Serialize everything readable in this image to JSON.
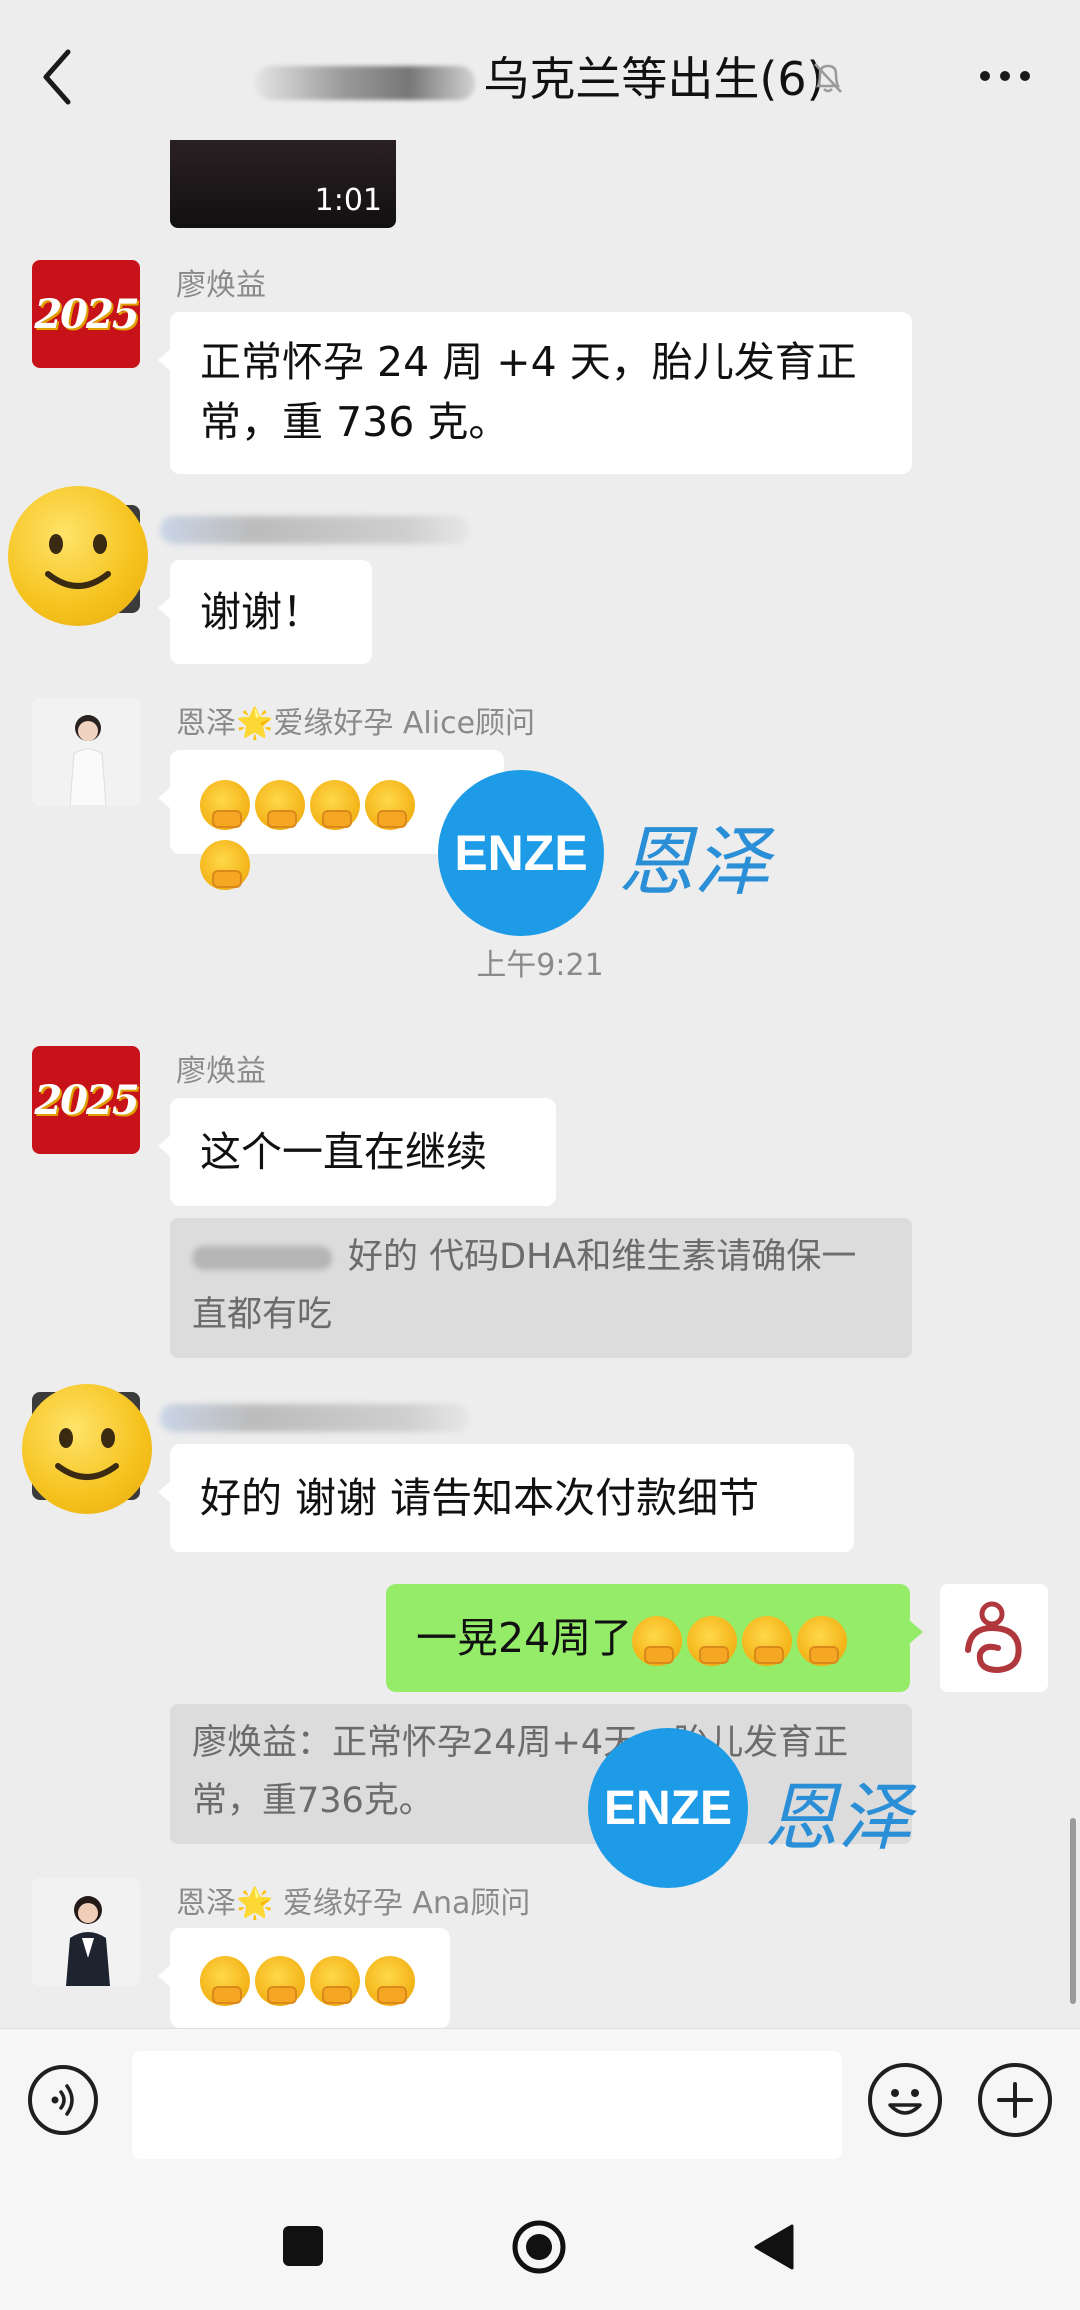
{
  "header": {
    "title": "乌克兰等出生(6)",
    "icons": [
      "back-icon",
      "mute-bell-icon",
      "more-icon"
    ]
  },
  "video": {
    "duration": "1:01"
  },
  "messages": {
    "m1": {
      "sender": "廖焕益",
      "avatar_text": "2025",
      "text_line1": "正常怀孕 24 周 +4 天，胎儿发育正",
      "text_line2": "常，重 736 克。"
    },
    "m2": {
      "text": "谢谢！"
    },
    "m3": {
      "sender": "恩泽🌟爱缘好孕 Alice顾问",
      "emoji_count": 5
    },
    "timestamp": "上午9:21",
    "m4": {
      "sender": "廖焕益",
      "avatar_text": "2025",
      "text": "这个一直在继续",
      "quote_line1": "好的 代码DHA和维生素请确保一",
      "quote_line2": "直都有吃"
    },
    "m5": {
      "text": "好的 谢谢 请告知本次付款细节"
    },
    "m6": {
      "text": "一晃24周了",
      "emoji_count": 4,
      "quote_line1": "廖焕益：正常怀孕24周+4天，胎儿发育正",
      "quote_line2": "常，重736克。"
    },
    "m7": {
      "sender": "恩泽🌟 爱缘好孕 Ana顾问",
      "emoji_count": 4
    }
  },
  "watermark": {
    "logo_text": "ENZE",
    "brand_text": "恩泽",
    "color": "#1e9be6"
  },
  "input": {
    "placeholder": "",
    "value": ""
  },
  "colors": {
    "background": "#ededed",
    "bubble_green": "#95ec69",
    "bubble_white": "#ffffff"
  }
}
